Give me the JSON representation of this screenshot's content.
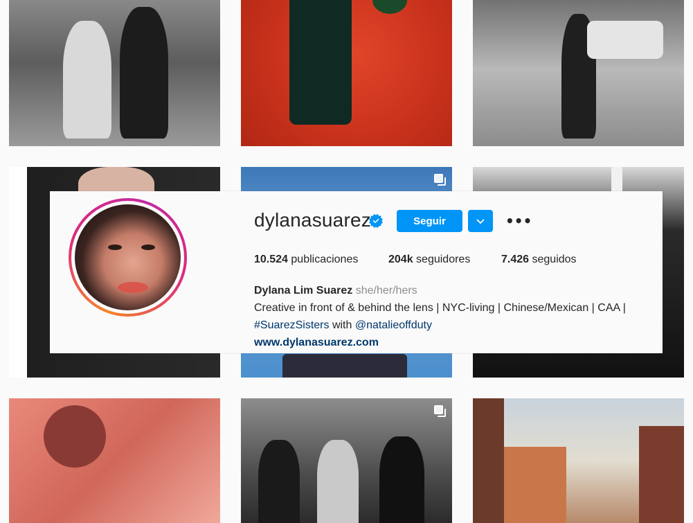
{
  "profile": {
    "username": "dylanasuarez",
    "follow_label": "Seguir",
    "more_label": "•••",
    "stats": {
      "posts_count": "10.524",
      "posts_label": "publicaciones",
      "followers_count": "204k",
      "followers_label": "seguidores",
      "following_count": "7.426",
      "following_label": "seguidos"
    },
    "bio": {
      "full_name": "Dylana Lim Suarez",
      "pronouns": "she/her/hers",
      "line1": "Creative in front of & behind the lens | NYC-living | Chinese/Mexican | CAA |",
      "hashtag": "#SuarezSisters",
      "with_text": " with ",
      "mention": "@natalieoffduty",
      "website": "www.dylanasuarez.com"
    }
  },
  "icons": {
    "verified": "verified-badge-icon",
    "dropdown": "chevron-down-icon",
    "multi": "multiple-posts-icon"
  },
  "colors": {
    "accent": "#0095f6",
    "link": "#00376b",
    "ring_start": "#f58529",
    "ring_end": "#dd2a7b"
  }
}
